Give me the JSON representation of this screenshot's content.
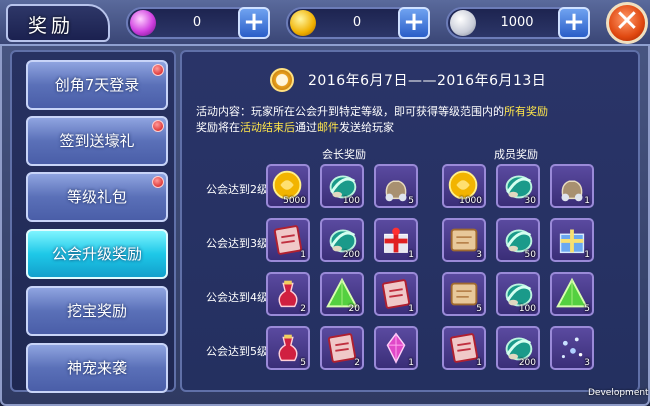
{
  "window": {
    "title": "奖励"
  },
  "currencies": [
    {
      "name": "gem",
      "value": "0",
      "add": "+"
    },
    {
      "name": "gold",
      "value": "0",
      "add": "+"
    },
    {
      "name": "silver",
      "value": "1000",
      "add": "+"
    }
  ],
  "close": "✕",
  "sidebar": {
    "items": [
      {
        "label": "创角7天登录",
        "active": false,
        "badge": true
      },
      {
        "label": "签到送壕礼",
        "active": false,
        "badge": true
      },
      {
        "label": "等级礼包",
        "active": false,
        "badge": true
      },
      {
        "label": "公会升级奖励",
        "active": true,
        "badge": false
      },
      {
        "label": "挖宝奖励",
        "active": false,
        "badge": false
      },
      {
        "label": "神宠来袭",
        "active": false,
        "badge": false
      }
    ]
  },
  "event": {
    "date_range": "2016年6月7日——2016年6月13日",
    "desc_line1": {
      "a": "活动内容：玩家所在公会升到特定等级，即可获得等级范围内的",
      "b": "所有奖励"
    },
    "desc_line2": {
      "a": "奖励将在",
      "b": "活动结束后",
      "c": "通过",
      "d": "邮件",
      "e": "发送给玩家"
    }
  },
  "columns": {
    "leader": "会长奖励",
    "member": "成员奖励"
  },
  "rows": [
    {
      "label": "公会达到2级",
      "leader": [
        {
          "icon": "gold-coin",
          "qty": "5000"
        },
        {
          "icon": "teal-orb",
          "qty": "100"
        },
        {
          "icon": "silver-sack",
          "qty": "5"
        }
      ],
      "member": [
        {
          "icon": "gold-coin",
          "qty": "1000"
        },
        {
          "icon": "teal-orb",
          "qty": "30"
        },
        {
          "icon": "silver-sack",
          "qty": "1"
        }
      ]
    },
    {
      "label": "公会达到3级",
      "leader": [
        {
          "icon": "red-scroll",
          "qty": "1"
        },
        {
          "icon": "teal-orb",
          "qty": "200"
        },
        {
          "icon": "red-gift-box",
          "qty": "1"
        }
      ],
      "member": [
        {
          "icon": "tan-scroll",
          "qty": "3"
        },
        {
          "icon": "teal-orb",
          "qty": "50"
        },
        {
          "icon": "blue-gift-box",
          "qty": "1"
        }
      ]
    },
    {
      "label": "公会达到4级",
      "leader": [
        {
          "icon": "red-potion",
          "qty": "2"
        },
        {
          "icon": "green-crystal",
          "qty": "20"
        },
        {
          "icon": "red-scroll",
          "qty": "1"
        }
      ],
      "member": [
        {
          "icon": "tan-scroll",
          "qty": "5"
        },
        {
          "icon": "teal-orb",
          "qty": "100"
        },
        {
          "icon": "green-crystal",
          "qty": "5"
        }
      ]
    },
    {
      "label": "公会达到5级",
      "leader": [
        {
          "icon": "red-potion",
          "qty": "5"
        },
        {
          "icon": "red-scroll",
          "qty": "2"
        },
        {
          "icon": "pink-gem",
          "qty": "1"
        }
      ],
      "member": [
        {
          "icon": "red-scroll",
          "qty": "1"
        },
        {
          "icon": "teal-orb",
          "qty": "200"
        },
        {
          "icon": "sparkle-dust",
          "qty": "3"
        }
      ]
    }
  ],
  "watermark": "Development"
}
